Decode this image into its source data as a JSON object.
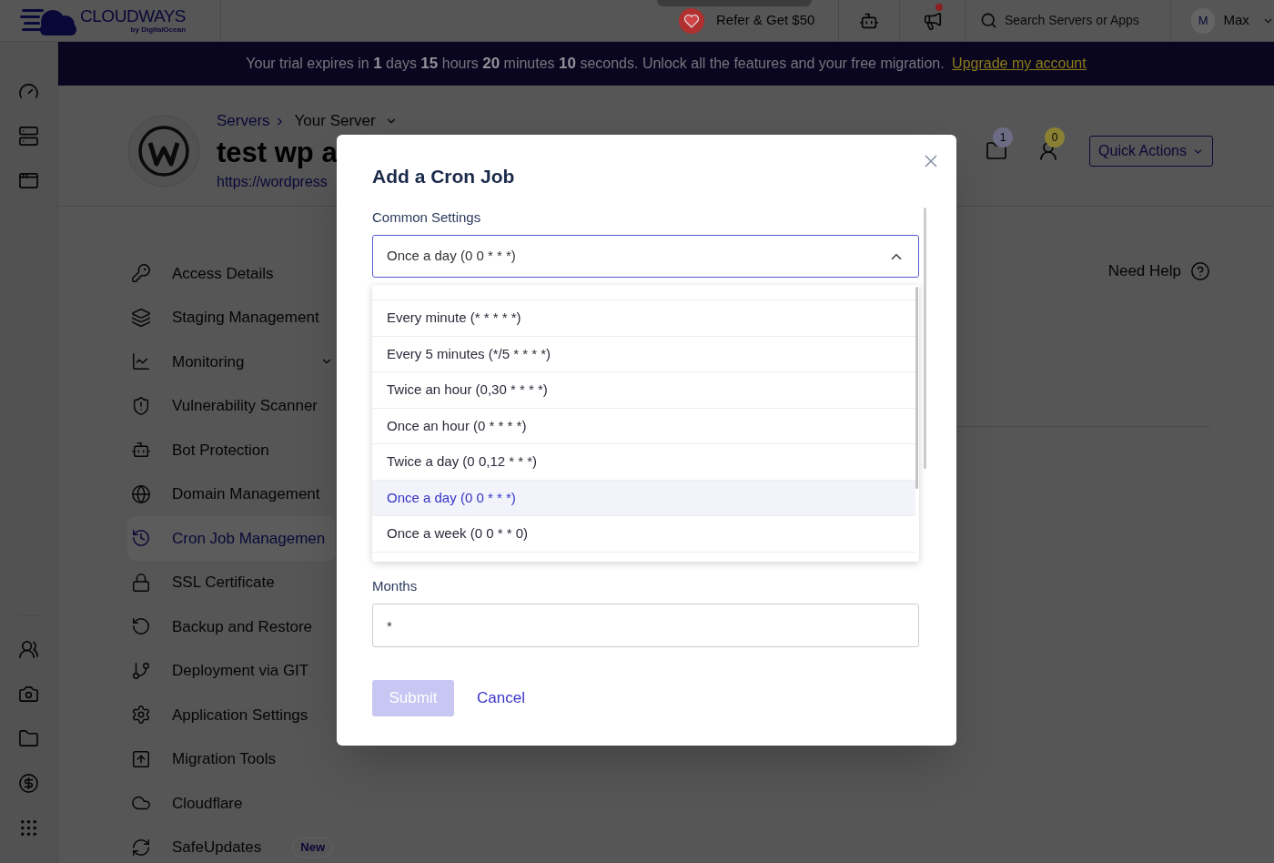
{
  "top_bar": {
    "logo": {
      "name": "CLOUDWAYS",
      "tagline": "by DigitalOcean"
    },
    "refer": "Refer & Get $50",
    "search": {
      "placeholder": "Search Servers or Apps"
    },
    "user": {
      "initial": "M",
      "name": "Max"
    }
  },
  "trial_banner": {
    "message": "Your trial expires in **1** days **15** hours **20** minutes **10** seconds. Unlock all the features and your free migration.",
    "link": "Upgrade my account"
  },
  "server_header": {
    "breadcrumb": {
      "parent": "Servers",
      "current": "Your Server"
    },
    "title": "test wp a",
    "url": "https://wordpress",
    "counters": [
      {
        "count": "1",
        "color": "#6e6c84"
      },
      {
        "count": "0",
        "color": "#8a8034"
      }
    ],
    "quick_actions": "Quick Actions"
  },
  "server_nav": {
    "items": [
      {
        "label": "Access Details",
        "kind": "link",
        "selected": false
      },
      {
        "label": "Staging Management",
        "kind": "link",
        "selected": false
      },
      {
        "label": "Monitoring",
        "kind": "submenu",
        "selected": false
      },
      {
        "label": "Vulnerability Scanner",
        "kind": "link",
        "selected": false
      },
      {
        "label": "Bot Protection",
        "kind": "link",
        "selected": false
      },
      {
        "label": "Domain Management",
        "kind": "link",
        "selected": false
      },
      {
        "label": "Cron Job Managemen",
        "kind": "link",
        "selected": true
      },
      {
        "label": "SSL Certificate",
        "kind": "link",
        "selected": false
      },
      {
        "label": "Backup and Restore",
        "kind": "link",
        "selected": false
      },
      {
        "label": "Deployment via GIT",
        "kind": "link",
        "selected": false
      },
      {
        "label": "Application Settings",
        "kind": "link",
        "selected": false
      },
      {
        "label": "Migration Tools",
        "kind": "link",
        "selected": false
      },
      {
        "label": "Cloudflare",
        "kind": "link",
        "selected": false
      },
      {
        "label": "SafeUpdates",
        "kind": "link",
        "selected": false,
        "badge": "New"
      }
    ]
  },
  "help": "Need Help",
  "modal": {
    "title": "Add a Cron Job",
    "common_settings": {
      "label": "Common Settings",
      "value": "Once a day (0 0 * * *)",
      "expanded": true,
      "options": [
        {
          "label": "Every minute (* * * * *)",
          "selected": false
        },
        {
          "label": "Every 5 minutes (*/5 * * * *)",
          "selected": false
        },
        {
          "label": "Twice an hour (0,30 * * * *)",
          "selected": false
        },
        {
          "label": "Once an hour (0 * * * *)",
          "selected": false
        },
        {
          "label": "Twice a day (0 0,12 * * *)",
          "selected": false
        },
        {
          "label": "Once a day (0 0 * * *)",
          "selected": true
        },
        {
          "label": "Once a week (0 0 * * 0)",
          "selected": false
        }
      ]
    },
    "months": {
      "label": "Months",
      "value": "*"
    },
    "submit": {
      "label": "Submit",
      "disabled": true
    },
    "cancel": "Cancel"
  }
}
